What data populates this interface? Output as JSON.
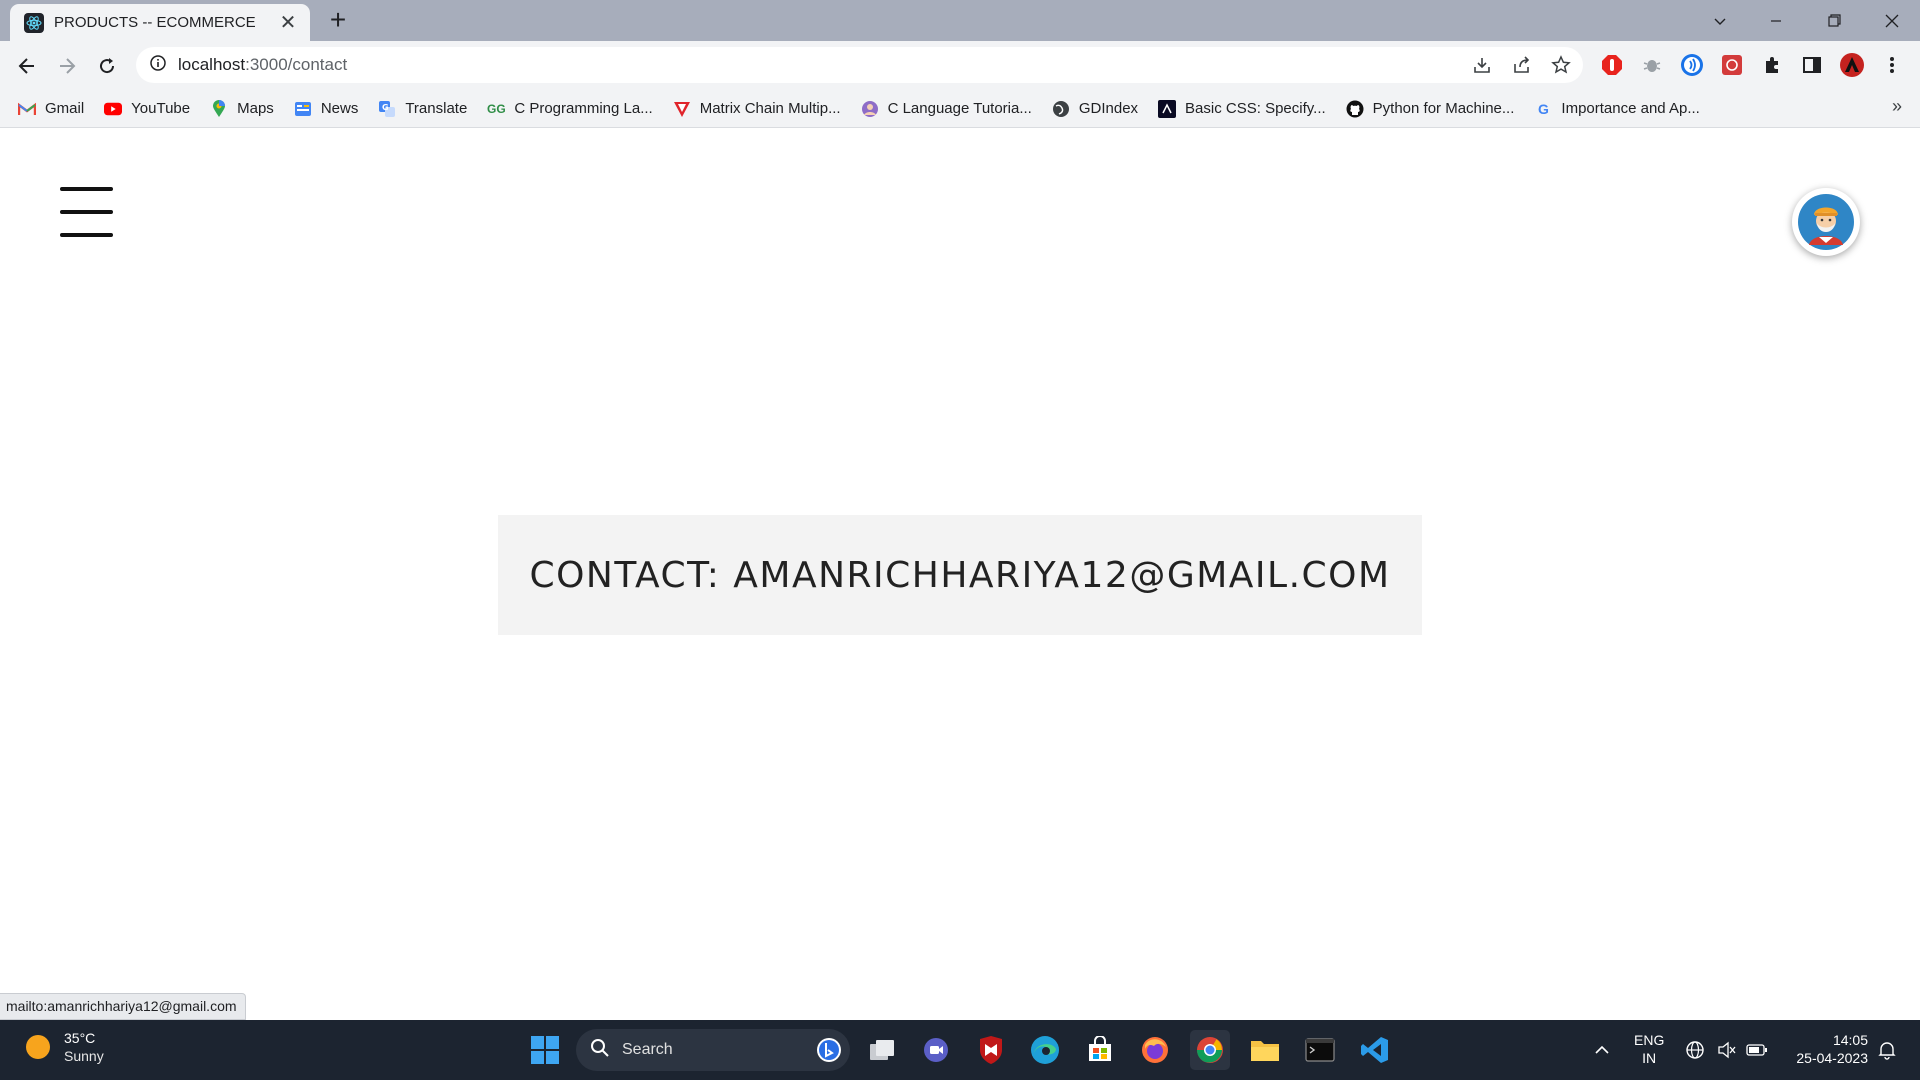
{
  "browser": {
    "tab_title": "PRODUCTS -- ECOMMERCE",
    "url_host": "localhost",
    "url_path": ":3000/contact"
  },
  "bookmarks": [
    {
      "label": "Gmail",
      "icon": "gmail-icon"
    },
    {
      "label": "YouTube",
      "icon": "youtube-icon"
    },
    {
      "label": "Maps",
      "icon": "maps-icon"
    },
    {
      "label": "News",
      "icon": "news-icon"
    },
    {
      "label": "Translate",
      "icon": "translate-icon"
    },
    {
      "label": "C Programming La...",
      "icon": "geeks-icon"
    },
    {
      "label": "Matrix Chain Multip...",
      "icon": "matrix-icon"
    },
    {
      "label": "C Language Tutoria...",
      "icon": "person-icon"
    },
    {
      "label": "GDIndex",
      "icon": "globe-icon"
    },
    {
      "label": "Basic CSS: Specify...",
      "icon": "fcc-icon"
    },
    {
      "label": "Python for Machine...",
      "icon": "github-icon"
    },
    {
      "label": "Importance and Ap...",
      "icon": "google-icon"
    }
  ],
  "page": {
    "contact_text": "CONTACT: AMANRICHHARIYA12@GMAIL.COM"
  },
  "status_bar": {
    "link": "mailto:amanrichhariya12@gmail.com"
  },
  "taskbar": {
    "weather_temp": "35°C",
    "weather_condition": "Sunny",
    "search_label": "Search",
    "lang_line1": "ENG",
    "lang_line2": "IN",
    "time": "14:05",
    "date": "25-04-2023"
  },
  "colors": {
    "tabbar": "#a7adbb",
    "toolbar": "#f2f3f5",
    "contact_box": "#f3f3f3",
    "taskbar": "#1c2430"
  }
}
